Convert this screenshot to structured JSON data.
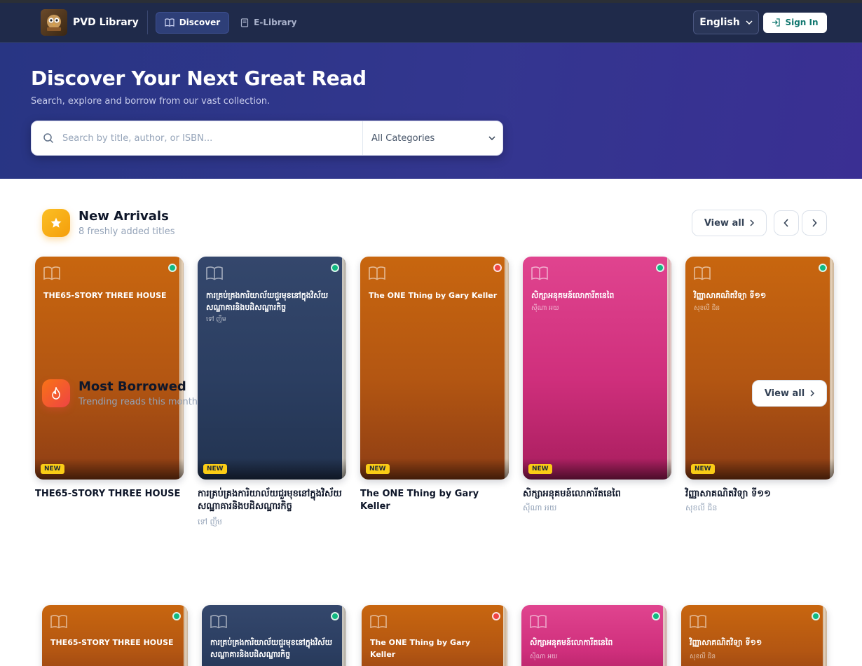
{
  "navbar": {
    "brand": "PVD Library",
    "tabs": [
      {
        "label": "Discover",
        "active": true
      },
      {
        "label": "E-Library",
        "active": false
      }
    ],
    "language": "English",
    "sign_in": "Sign In"
  },
  "hero": {
    "title": "Discover Your Next Great Read",
    "subtitle": "Search, explore and borrow from our vast collection.",
    "search_placeholder": "Search by title, author, or ISBN...",
    "category_selected": "All Categories"
  },
  "new_arrivals": {
    "title": "New Arrivals",
    "subtitle": "8 freshly added titles",
    "view_all": "View all",
    "badge": "NEW",
    "books": [
      {
        "title": "THE65-STORY THREE HOUSE",
        "author": "",
        "color": "orange",
        "status": "available"
      },
      {
        "title": "ការគ្រប់គ្រងការិយាល័យជួរមុខនៅក្នុងវិស័យសណ្ឋាគារនិងបដិសណ្ឋារកិច្ច",
        "author": "ទៅ ញឹម",
        "color": "navy",
        "status": "available"
      },
      {
        "title": "The ONE Thing by Gary Keller",
        "author": "",
        "color": "orange",
        "status": "unavailable"
      },
      {
        "title": "សិក្សាអនុគមន៍លោការីតនេពៃ",
        "author": "ស៊ីណា អយ",
        "color": "pink",
        "status": "available"
      },
      {
        "title": "វិញ្ញាសាគណិតវិទ្យា ទី១១",
        "author": "សុខលី ជិន",
        "color": "orange",
        "status": "available"
      }
    ]
  },
  "most_borrowed": {
    "title": "Most Borrowed",
    "subtitle": "Trending reads this month",
    "view_all": "View all",
    "books": [
      {
        "title": "THE65-STORY THREE HOUSE",
        "author": "",
        "color": "orange",
        "status": "available"
      },
      {
        "title": "ការគ្រប់គ្រងការិយាល័យជួរមុខនៅក្នុងវិស័យសណ្ឋាគារនិងបដិសណ្ឋារកិច្ច",
        "author": "",
        "color": "navy",
        "status": "available"
      },
      {
        "title": "The ONE Thing by Gary Keller",
        "author": "",
        "color": "orange",
        "status": "unavailable"
      },
      {
        "title": "សិក្សាអនុគមន៍លោការីតនេពៃ",
        "author": "ស៊ីណា អយ",
        "color": "pink",
        "status": "available"
      },
      {
        "title": "វិញ្ញាសាគណិតវិទ្យា ទី១១",
        "author": "សុខលី ជិន",
        "color": "orange",
        "status": "available"
      }
    ]
  },
  "colors": {
    "navbar": "#1f2a4a",
    "hero": "#2f3588",
    "available": "#10b981",
    "unavailable": "#ef4444",
    "badge": "#facc15"
  }
}
